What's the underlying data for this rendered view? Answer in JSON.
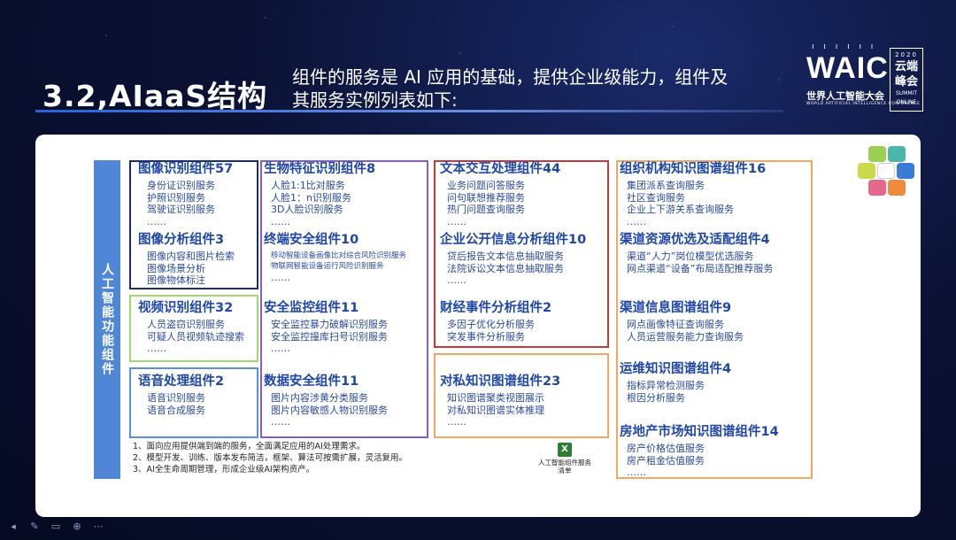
{
  "slide": {
    "title": "3.2,AIaaS结构",
    "subtitle_line1": "组件的服务是 AI 应用的基础，提供企业级能力，组件及",
    "subtitle_line2": "其服务实例列表如下:"
  },
  "logo": {
    "waic": "WAIC",
    "name_zh": "世界人工智能大会",
    "name_en": "WORLD ARTIFICIAL INTELLIGENCE CONFERENCE",
    "year": "2020",
    "yun": "云端",
    "feng": "峰会",
    "summit": "SUMMIT",
    "online": "ONLINE"
  },
  "side_label": "人工智能功能组件",
  "col1": {
    "g1": {
      "title": "图像识别组件57",
      "items": [
        "身份证识别服务",
        "护照识别服务",
        "驾驶证识别服务",
        "……"
      ]
    },
    "g2": {
      "title": "图像分析组件3",
      "items": [
        "图像内容和图片检索",
        "图像场景分析",
        "图像物体标注"
      ]
    },
    "g3": {
      "title": "视频识别组件32",
      "items": [
        "人员盗窃识别服务",
        "可疑人员视频轨迹搜索",
        "……"
      ]
    },
    "g4": {
      "title": "语音处理组件2",
      "items": [
        "语音识别服务",
        "语音合成服务"
      ]
    }
  },
  "col2": {
    "g1": {
      "title": "生物特征识别组件8",
      "items": [
        "人脸1:1比对服务",
        "人脸1：n识别服务",
        "3D人脸识别服务",
        "……"
      ]
    },
    "g2": {
      "title": "终端安全组件10",
      "items": [
        "移动智能设备画像比对综合风险识别服务",
        "物联网智能设备运行风险识别服务",
        "……"
      ]
    },
    "g3": {
      "title": "安全监控组件11",
      "items": [
        "安全监控暴力破解识别服务",
        "安全监控撞库扫号识别服务",
        "……"
      ]
    },
    "g4": {
      "title": "数据安全组件11",
      "items": [
        "图片内容涉黄分类服务",
        "图片内容敏感人物识别服务",
        "……"
      ]
    }
  },
  "col3": {
    "g1": {
      "title": "文本交互处理组件44",
      "items": [
        "业务问题问答服务",
        "问句联想推荐服务",
        "热门问题查询服务",
        "……"
      ]
    },
    "g2": {
      "title": "企业公开信息分析组件10",
      "items": [
        "贷后报告文本信息抽取服务",
        "法院诉讼文本信息抽取服务",
        "……"
      ]
    },
    "g3": {
      "title": "财经事件分析组件2",
      "items": [
        "多因子优化分析服务",
        "突发事件分析服务"
      ]
    },
    "g4": {
      "title": "对私知识图谱组件23",
      "items": [
        "知识图谱聚类视图展示",
        "对私知识图谱实体推理",
        "……"
      ]
    }
  },
  "col4": {
    "g1": {
      "title": "组织机构知识图谱组件16",
      "items": [
        "集团派系查询服务",
        "社区查询服务",
        "企业上下游关系查询服务",
        "……"
      ]
    },
    "g2": {
      "title": "渠道资源优选及适配组件4",
      "items": [
        "渠道“人力”岗位模型优选服务",
        "网点渠道“设备”布局适配推荐服务"
      ]
    },
    "g3": {
      "title": "渠道信息图谱组件9",
      "items": [
        "网点画像特征查询服务",
        "人员运营服务能力查询服务"
      ]
    },
    "g4": {
      "title": "运维知识图谱组件4",
      "items": [
        "指标异常检测服务",
        "根因分析服务"
      ]
    },
    "g5": {
      "title": "房地产市场知识图谱组件14",
      "items": [
        "房产价格估值服务",
        "房产租金估值服务",
        "……"
      ]
    }
  },
  "notes": [
    "1、面向应用提供端到端的服务，全面满足应用的AI处理需求。",
    "2、模型开发、训练、版本发布简洁，框架、算法可按需扩展，灵活复用。",
    "3、AI全生命周期管理，形成企业级AI架构资产。"
  ],
  "file_label_1": "人工智能组件服务",
  "file_label_2": "清单",
  "colors": {
    "navy": "#1d2f6b",
    "green": "#9fd86b",
    "blue": "#5b8fd8",
    "purple": "#8a5cc8",
    "red": "#c23a3a",
    "orange": "#f0a860",
    "side_bar": "#4f86d6"
  }
}
